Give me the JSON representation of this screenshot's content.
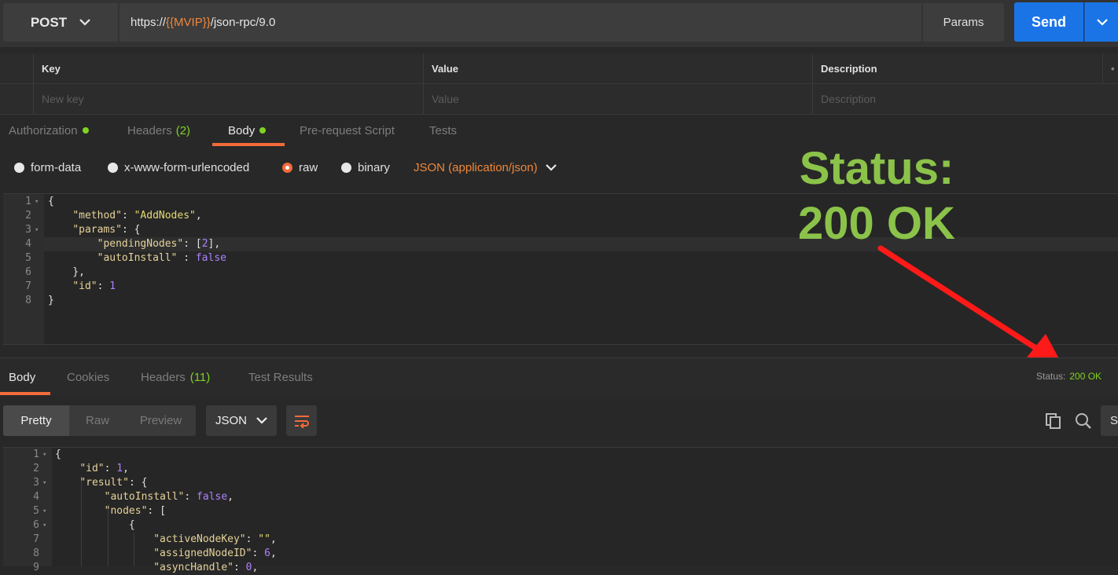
{
  "request": {
    "method": "POST",
    "url_prefix": "https://",
    "url_var": "{{MVIP}}",
    "url_suffix": "/json-rpc/9.0",
    "params_label": "Params",
    "send_label": "Send"
  },
  "params_table": {
    "headers": [
      "Key",
      "Value",
      "Description"
    ],
    "placeholders": [
      "New key",
      "Value",
      "Description"
    ],
    "more": "•"
  },
  "request_tabs": [
    {
      "label": "Authorization",
      "count": "",
      "dot": true
    },
    {
      "label": "Headers",
      "count": "(2)",
      "dot": false
    },
    {
      "label": "Body",
      "count": "",
      "dot": true,
      "active": true
    },
    {
      "label": "Pre-request Script",
      "count": "",
      "dot": false
    },
    {
      "label": "Tests",
      "count": "",
      "dot": false
    }
  ],
  "body_modes": {
    "options": [
      "form-data",
      "x-www-form-urlencoded",
      "raw",
      "binary"
    ],
    "selected": "raw",
    "content_type": "JSON (application/json)"
  },
  "request_body": [
    {
      "n": "1",
      "fold": true,
      "t": [
        {
          "c": "p",
          "v": "{"
        }
      ]
    },
    {
      "n": "2",
      "t": [
        {
          "c": "p",
          "v": "    "
        },
        {
          "c": "k",
          "v": "\"method\""
        },
        {
          "c": "p",
          "v": ": "
        },
        {
          "c": "s",
          "v": "\"AddNodes\""
        },
        {
          "c": "p",
          "v": ","
        }
      ]
    },
    {
      "n": "3",
      "fold": true,
      "t": [
        {
          "c": "p",
          "v": "    "
        },
        {
          "c": "k",
          "v": "\"params\""
        },
        {
          "c": "p",
          "v": ": {"
        }
      ]
    },
    {
      "n": "4",
      "t": [
        {
          "c": "p",
          "v": "        "
        },
        {
          "c": "k",
          "v": "\"pendingNodes\""
        },
        {
          "c": "p",
          "v": ": ["
        },
        {
          "c": "n",
          "v": "2"
        },
        {
          "c": "p",
          "v": "],"
        }
      ]
    },
    {
      "n": "5",
      "t": [
        {
          "c": "p",
          "v": "        "
        },
        {
          "c": "k",
          "v": "\"autoInstall\""
        },
        {
          "c": "p",
          "v": " : "
        },
        {
          "c": "b",
          "v": "false"
        }
      ]
    },
    {
      "n": "6",
      "t": [
        {
          "c": "p",
          "v": "    },"
        }
      ]
    },
    {
      "n": "7",
      "t": [
        {
          "c": "p",
          "v": "    "
        },
        {
          "c": "k",
          "v": "\"id\""
        },
        {
          "c": "p",
          "v": ": "
        },
        {
          "c": "n",
          "v": "1"
        }
      ]
    },
    {
      "n": "8",
      "t": [
        {
          "c": "p",
          "v": "}"
        }
      ]
    }
  ],
  "annotation": {
    "line1": "Status:",
    "line2": "200 OK",
    "arrow_color": "#ff1a1a",
    "text_color": "#8bc34a"
  },
  "response_tabs": [
    {
      "label": "Body",
      "count": "",
      "active": true
    },
    {
      "label": "Cookies",
      "count": ""
    },
    {
      "label": "Headers",
      "count": "(11)"
    },
    {
      "label": "Test Results",
      "count": ""
    }
  ],
  "response_status": {
    "label": "Status:",
    "value": "200 OK"
  },
  "response_view": {
    "modes": [
      "Pretty",
      "Raw",
      "Preview"
    ],
    "selected": "Pretty",
    "format": "JSON",
    "save_label": "S"
  },
  "response_body": [
    {
      "n": "1",
      "fold": true,
      "t": [
        {
          "c": "p",
          "v": "{"
        }
      ]
    },
    {
      "n": "2",
      "t": [
        {
          "c": "p",
          "v": "    "
        },
        {
          "c": "k",
          "v": "\"id\""
        },
        {
          "c": "p",
          "v": ": "
        },
        {
          "c": "n",
          "v": "1"
        },
        {
          "c": "p",
          "v": ","
        }
      ]
    },
    {
      "n": "3",
      "fold": true,
      "t": [
        {
          "c": "p",
          "v": "    "
        },
        {
          "c": "k",
          "v": "\"result\""
        },
        {
          "c": "p",
          "v": ": {"
        }
      ]
    },
    {
      "n": "4",
      "t": [
        {
          "c": "p",
          "v": "        "
        },
        {
          "c": "k",
          "v": "\"autoInstall\""
        },
        {
          "c": "p",
          "v": ": "
        },
        {
          "c": "b",
          "v": "false"
        },
        {
          "c": "p",
          "v": ","
        }
      ]
    },
    {
      "n": "5",
      "fold": true,
      "t": [
        {
          "c": "p",
          "v": "        "
        },
        {
          "c": "k",
          "v": "\"nodes\""
        },
        {
          "c": "p",
          "v": ": ["
        }
      ]
    },
    {
      "n": "6",
      "fold": true,
      "t": [
        {
          "c": "p",
          "v": "            {"
        }
      ]
    },
    {
      "n": "7",
      "t": [
        {
          "c": "p",
          "v": "                "
        },
        {
          "c": "k",
          "v": "\"activeNodeKey\""
        },
        {
          "c": "p",
          "v": ": "
        },
        {
          "c": "s",
          "v": "\"\""
        },
        {
          "c": "p",
          "v": ","
        }
      ]
    },
    {
      "n": "8",
      "t": [
        {
          "c": "p",
          "v": "                "
        },
        {
          "c": "k",
          "v": "\"assignedNodeID\""
        },
        {
          "c": "p",
          "v": ": "
        },
        {
          "c": "n",
          "v": "6"
        },
        {
          "c": "p",
          "v": ","
        }
      ]
    },
    {
      "n": "9",
      "t": [
        {
          "c": "p",
          "v": "                "
        },
        {
          "c": "k",
          "v": "\"asyncHandle\""
        },
        {
          "c": "p",
          "v": ": "
        },
        {
          "c": "n",
          "v": "0"
        },
        {
          "c": "p",
          "v": ","
        }
      ]
    }
  ]
}
